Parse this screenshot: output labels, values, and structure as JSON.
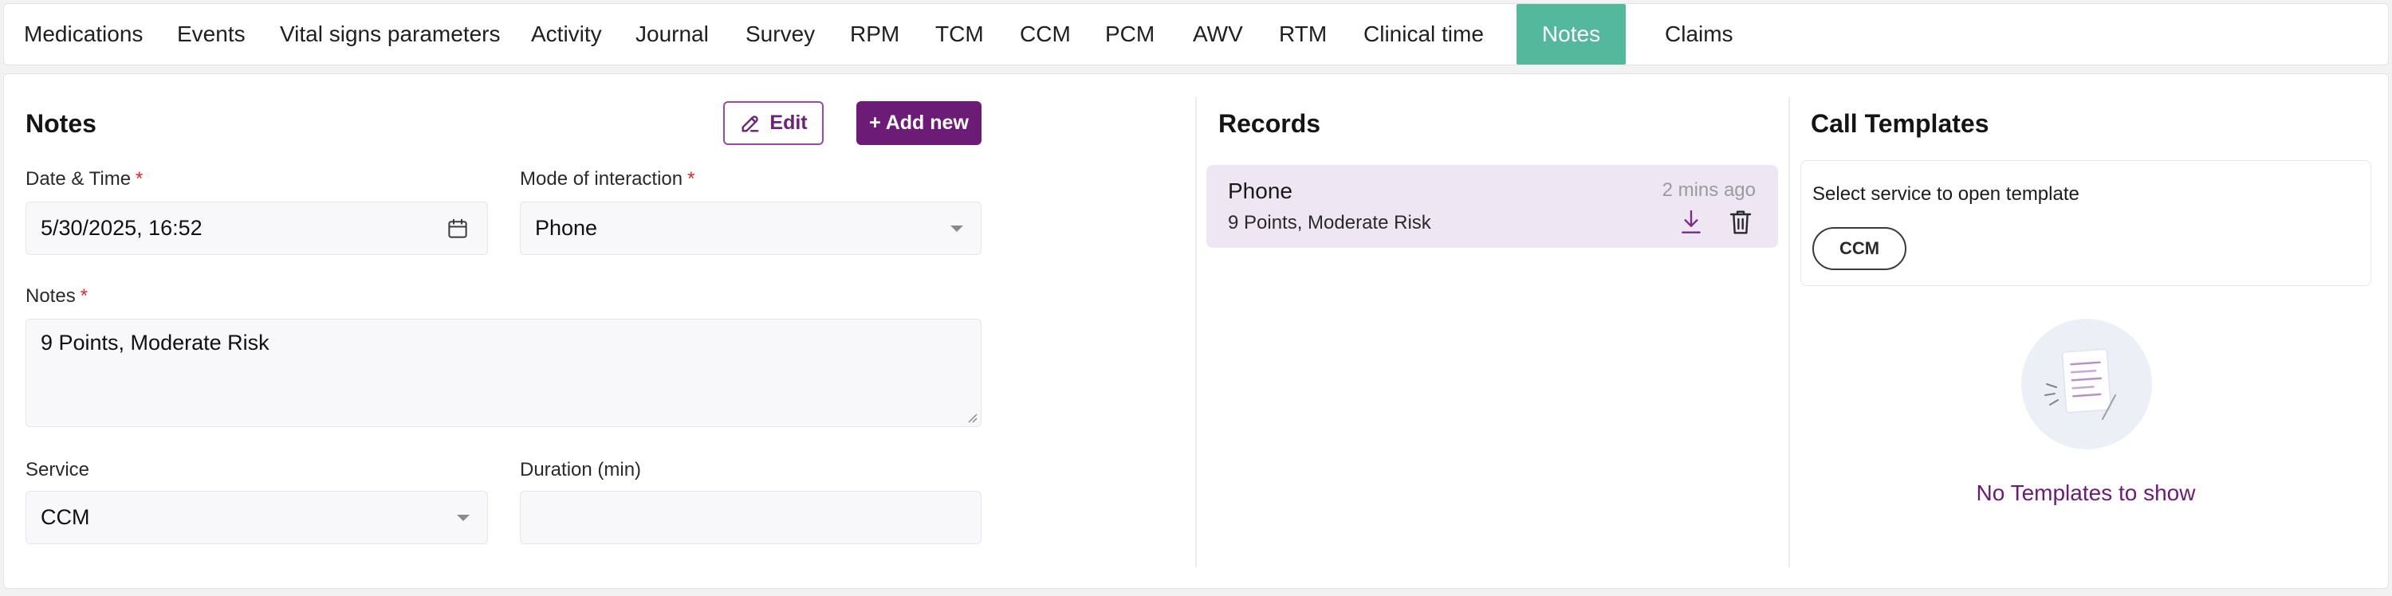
{
  "tabs": [
    {
      "label": "Medications",
      "active": false
    },
    {
      "label": "Events",
      "active": false
    },
    {
      "label": "Vital signs parameters",
      "active": false
    },
    {
      "label": "Activity",
      "active": false
    },
    {
      "label": "Journal",
      "active": false
    },
    {
      "label": "Survey",
      "active": false
    },
    {
      "label": "RPM",
      "active": false
    },
    {
      "label": "TCM",
      "active": false
    },
    {
      "label": "CCM",
      "active": false
    },
    {
      "label": "PCM",
      "active": false
    },
    {
      "label": "AWV",
      "active": false
    },
    {
      "label": "RTM",
      "active": false
    },
    {
      "label": "Clinical time",
      "active": false
    },
    {
      "label": "Notes",
      "active": true
    },
    {
      "label": "Claims",
      "active": false
    }
  ],
  "notes": {
    "title": "Notes",
    "edit_label": "Edit",
    "add_label": "+ Add new",
    "date_label": "Date & Time",
    "date_value": "5/30/2025, 16:52",
    "mode_label": "Mode of interaction",
    "mode_value": "Phone",
    "notes_label": "Notes",
    "notes_value": "9 Points, Moderate Risk",
    "service_label": "Service",
    "service_value": "CCM",
    "duration_label": "Duration (min)",
    "duration_value": "",
    "required_mark": "*"
  },
  "records": {
    "title": "Records",
    "items": [
      {
        "type": "Phone",
        "time": "2 mins ago",
        "note": "9 Points, Moderate Risk"
      }
    ]
  },
  "templates": {
    "title": "Call Templates",
    "hint": "Select service to open template",
    "service_pill": "CCM",
    "empty_text": "No Templates to show"
  },
  "colors": {
    "accent": "#6c1b77",
    "active_tab": "#54b89c",
    "record_bg": "#efe6f4",
    "required": "#e02a2a"
  },
  "icons": {
    "edit": "pencil-icon",
    "date": "calendar-icon",
    "dropdown": "caret-down-icon",
    "download": "download-icon",
    "delete": "trash-icon",
    "empty": "document-illustration-icon"
  }
}
